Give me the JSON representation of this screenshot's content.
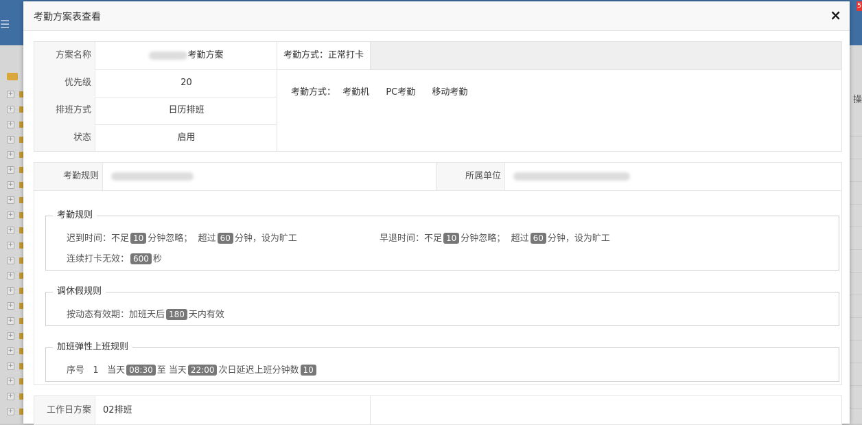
{
  "background": {
    "badge": "5",
    "right_column_label": "操"
  },
  "modal": {
    "title": "考勤方案表查看",
    "close": "×"
  },
  "basic": {
    "fields": [
      {
        "label": "方案名称",
        "value": "考勤方案"
      },
      {
        "label": "优先级",
        "value": "20"
      },
      {
        "label": "排班方式",
        "value": "日历排班"
      },
      {
        "label": "状态",
        "value": "启用"
      }
    ],
    "tab": "考勤方式：正常打卡",
    "methods_label": "考勤方式：",
    "methods": [
      "考勤机",
      "PC考勤",
      "移动考勤"
    ]
  },
  "rules": {
    "rule_label": "考勤规则",
    "unit_label": "所属单位",
    "attendance": {
      "legend": "考勤规则",
      "late_prefix": "迟到时间：不足",
      "late_ignore": "10",
      "ignore_text": "分钟忽略；",
      "over_text": "超过",
      "late_absent": "60",
      "absent_text": "分钟，设为旷工",
      "early_prefix": "早退时间：不足",
      "early_ignore": "10",
      "early_absent": "60",
      "repeat_prefix": "连续打卡无效：",
      "repeat_value": "600",
      "repeat_unit": "秒"
    },
    "leave": {
      "legend": "调休假规则",
      "prefix": "按动态有效期：加班天后",
      "days": "180",
      "suffix": "天内有效"
    },
    "overtime": {
      "legend": "加班弹性上班规则",
      "seq_label": "序号",
      "seq": "1",
      "day_label": "当天",
      "start": "08:30",
      "to": "至",
      "end": "22:00",
      "delay_text": "次日延迟上班分钟数",
      "delay": "10"
    }
  },
  "workday": {
    "label": "工作日方案",
    "value": "02排班"
  }
}
